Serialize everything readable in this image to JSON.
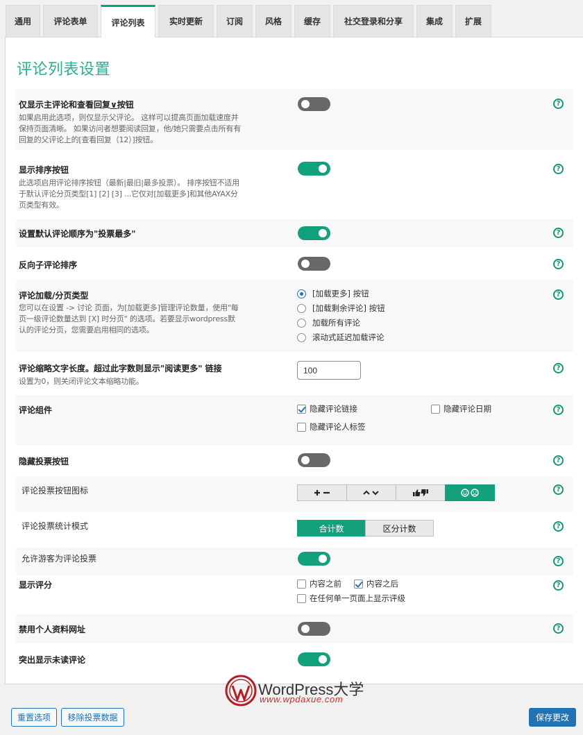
{
  "tabs": [
    "通用",
    "评论表单",
    "评论列表",
    "实时更新",
    "订阅",
    "风格",
    "缓存",
    "社交登录和分享",
    "集成",
    "扩展"
  ],
  "active_tab": "评论列表",
  "page_title": "评论列表设置",
  "help_glyph": "?",
  "settings": {
    "show_replies": {
      "label_pre": "仅显示主评论和查看回复",
      "label_link": "∨",
      "label_post": "按钮",
      "desc": "如果启用此选项，则仅显示父评论。 这样可以提高页面加载速度并保持页面清晰。 如果访问者想要阅读回复，他/她只需要点击所有有回复的父评论上的[查看回复（12）]按钮。",
      "enabled": false
    },
    "sort_buttons": {
      "label": "显示排序按钮",
      "desc": "此选项启用评论排序按钮（最新|最旧|最多投票）。 排序按钮不适用于默认评论分页类型[1] [2] [3] ...它仅对[加载更多]和其他AYAX分页类型有效。",
      "enabled": true
    },
    "default_order": {
      "label": "设置默认评论顺序为\"投票最多\"",
      "enabled": true
    },
    "reverse_children": {
      "label": "反向子评论排序",
      "enabled": false
    },
    "pagination": {
      "label": "评论加载/分页类型",
      "desc": "您可以在设置 -> 讨论 页面，为[加载更多]管理评论数量，使用\"每页一级评论数量达到 [X] 时分页\" 的选项。若要显示wordpress默认的评论分页，您需要启用相同的选项。",
      "options": [
        "[加载更多] 按钮",
        "[加载剩余评论] 按钮",
        "加载所有评论",
        "滚动式延迟加载评论"
      ],
      "selected": 0
    },
    "excerpt_length": {
      "label": "评论缩略文字长度。超过此字数则显示\"阅读更多\" 链接",
      "desc": "设置为0，则关闭评论文本缩略功能。",
      "value": "100"
    },
    "components": {
      "label": "评论组件",
      "options": [
        {
          "label": "隐藏评论链接",
          "checked": true
        },
        {
          "label": "隐藏评论日期",
          "checked": false
        },
        {
          "label": "隐藏评论人标签",
          "checked": false
        }
      ]
    },
    "hide_vote_buttons": {
      "label": "隐藏投票按钮",
      "enabled": false
    },
    "vote_icons": {
      "label": "评论投票按钮图标",
      "options": [
        "plus-minus-icons",
        "chevron-up-down-icons",
        "thumbs-up-down-icons",
        "smiley-frowny-icons"
      ],
      "selected": 3
    },
    "vote_count_mode": {
      "label": "评论投票统计模式",
      "options": [
        "合计数",
        "区分计数"
      ],
      "selected": 0
    },
    "guest_vote": {
      "label": "允许游客为评论投票",
      "enabled": true
    },
    "show_rating": {
      "label": "显示评分",
      "options": [
        {
          "label": "内容之前",
          "checked": false
        },
        {
          "label": "内容之后",
          "checked": true
        },
        {
          "label": "在任何单一页面上显示评级",
          "checked": false
        }
      ]
    },
    "disable_profile_url": {
      "label": "禁用个人资料网址",
      "enabled": false
    },
    "highlight_unread": {
      "label": "突出显示未读评论",
      "enabled": true
    }
  },
  "buttons": {
    "reset": "重置选项",
    "remove_votes": "移除投票数据",
    "save": "保存更改"
  },
  "watermark": {
    "name": "WordPress大学",
    "url": "www.wpdaxue.com"
  },
  "colors": {
    "accent": "#13a07d",
    "title": "#2eae8f",
    "toggle_off": "#686868",
    "primary": "#2271b1"
  }
}
